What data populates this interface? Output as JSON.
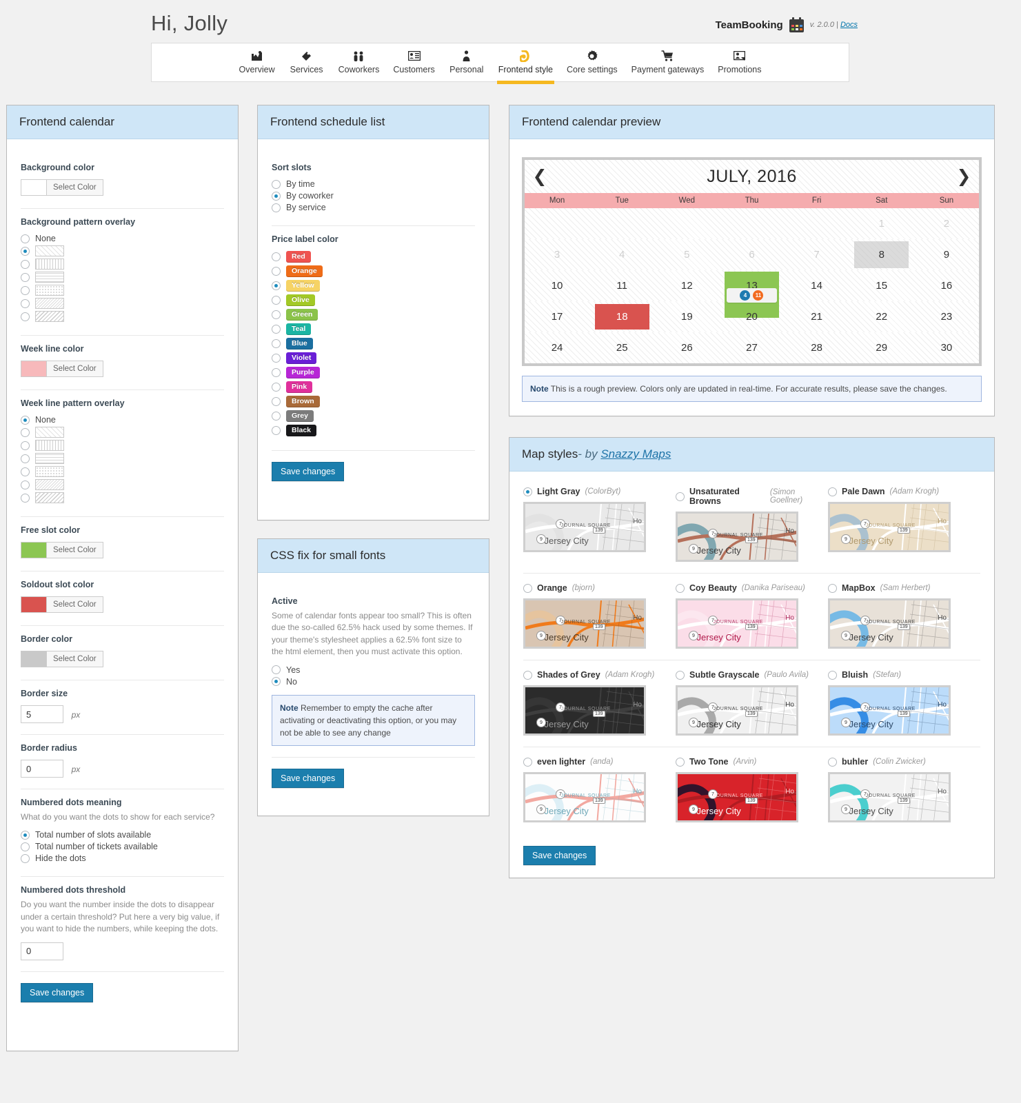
{
  "header": {
    "greeting": "Hi, Jolly",
    "brand": "TeamBooking",
    "version": "v. 2.0.0",
    "sep": "|",
    "docs": "Docs",
    "logo_icon": "calendar-logo-icon"
  },
  "nav": {
    "tabs": [
      {
        "label": "Overview",
        "icon": "chart-icon",
        "active": false
      },
      {
        "label": "Services",
        "icon": "tag-icon",
        "active": false
      },
      {
        "label": "Coworkers",
        "icon": "people-icon",
        "active": false
      },
      {
        "label": "Customers",
        "icon": "contact-card-icon",
        "active": false
      },
      {
        "label": "Personal",
        "icon": "person-icon",
        "active": false
      },
      {
        "label": "Frontend style",
        "icon": "brush-icon",
        "active": true
      },
      {
        "label": "Core settings",
        "icon": "gear-icon",
        "active": false
      },
      {
        "label": "Payment gateways",
        "icon": "cart-icon",
        "active": false
      },
      {
        "label": "Promotions",
        "icon": "megaphone-icon",
        "active": false
      }
    ],
    "accent": "#f5b820"
  },
  "frontend_calendar": {
    "title": "Frontend calendar",
    "background_color": {
      "label": "Background color",
      "swatch": "#ffffff",
      "button": "Select Color"
    },
    "background_pattern": {
      "label": "Background pattern overlay",
      "none_label": "None",
      "selected_index": 1,
      "count": 7
    },
    "week_line_color": {
      "label": "Week line color",
      "swatch": "#f7b9bb",
      "button": "Select Color"
    },
    "week_line_pattern": {
      "label": "Week line pattern overlay",
      "none_label": "None",
      "selected_index": 0,
      "count": 7
    },
    "free_slot_color": {
      "label": "Free slot color",
      "swatch": "#8cc653",
      "button": "Select Color"
    },
    "soldout_slot_color": {
      "label": "Soldout slot color",
      "swatch": "#d9534f",
      "button": "Select Color"
    },
    "border_color": {
      "label": "Border color",
      "swatch": "#c9c9c9",
      "button": "Select Color"
    },
    "border_size": {
      "label": "Border size",
      "value": "5",
      "unit": "px"
    },
    "border_radius": {
      "label": "Border radius",
      "value": "0",
      "unit": "px"
    },
    "numbered_dots_meaning": {
      "label": "Numbered dots meaning",
      "help": "What do you want the dots to show for each service?",
      "options": [
        "Total number of slots available",
        "Total number of tickets available",
        "Hide the dots"
      ],
      "selected_index": 0
    },
    "numbered_dots_threshold": {
      "label": "Numbered dots threshold",
      "help": "Do you want the number inside the dots to disappear under a certain threshold? Put here a very big value, if you want to hide the numbers, while keeping the dots.",
      "value": "0"
    },
    "save_label": "Save changes"
  },
  "frontend_schedule_list": {
    "title": "Frontend schedule list",
    "sort_slots": {
      "label": "Sort slots",
      "options": [
        "By time",
        "By coworker",
        "By service"
      ],
      "selected_index": 1
    },
    "price_label_color": {
      "label": "Price label color",
      "selected_index": 2,
      "options": [
        {
          "name": "Red",
          "color": "#ef5350"
        },
        {
          "name": "Orange",
          "color": "#ef6c18"
        },
        {
          "name": "Yellow",
          "color": "#f6d365"
        },
        {
          "name": "Olive",
          "color": "#a3c926"
        },
        {
          "name": "Green",
          "color": "#8bc34a"
        },
        {
          "name": "Teal",
          "color": "#1bb5a3"
        },
        {
          "name": "Blue",
          "color": "#1b6fa0"
        },
        {
          "name": "Violet",
          "color": "#6a1fd6"
        },
        {
          "name": "Purple",
          "color": "#b726d6"
        },
        {
          "name": "Pink",
          "color": "#e0309b"
        },
        {
          "name": "Brown",
          "color": "#a96a39"
        },
        {
          "name": "Grey",
          "color": "#7c7c7c"
        },
        {
          "name": "Black",
          "color": "#18181a"
        }
      ]
    },
    "save_label": "Save changes"
  },
  "css_fix": {
    "title": "CSS fix for small fonts",
    "active_label": "Active",
    "description": "Some of calendar fonts appear too small? This is often due the so-called 62.5% hack used by some themes. If your theme's stylesheet applies a 62.5% font size to the html element, then you must activate this option.",
    "options": [
      "Yes",
      "No"
    ],
    "selected_index": 1,
    "note_title": "Note",
    "note_text": "Remember to empty the cache after activating or deactivating this option, or you may not be able to see any change",
    "save_label": "Save changes"
  },
  "calendar_preview": {
    "title": "Frontend calendar preview",
    "month": "JULY, 2016",
    "prev_icon": "chevron-left-icon",
    "next_icon": "chevron-right-icon",
    "dow": [
      "Mon",
      "Tue",
      "Wed",
      "Thu",
      "Fri",
      "Sat",
      "Sun"
    ],
    "weeks": [
      [
        {
          "d": "",
          "s": "empty"
        },
        {
          "d": "",
          "s": "empty"
        },
        {
          "d": "",
          "s": "empty"
        },
        {
          "d": "",
          "s": "empty"
        },
        {
          "d": "",
          "s": "empty"
        },
        {
          "d": "1",
          "s": "mut"
        },
        {
          "d": "2",
          "s": "mut"
        }
      ],
      [
        {
          "d": "3",
          "s": "mut"
        },
        {
          "d": "4",
          "s": "mut"
        },
        {
          "d": "5",
          "s": "mut"
        },
        {
          "d": "6",
          "s": "mut"
        },
        {
          "d": "7",
          "s": "mut"
        },
        {
          "d": "8",
          "s": "today"
        },
        {
          "d": "9",
          "s": "normal"
        }
      ],
      [
        {
          "d": "10",
          "s": "normal"
        },
        {
          "d": "11",
          "s": "normal"
        },
        {
          "d": "12",
          "s": "normal"
        },
        {
          "d": "13",
          "s": "free"
        },
        {
          "d": "14",
          "s": "normal"
        },
        {
          "d": "15",
          "s": "normal"
        },
        {
          "d": "16",
          "s": "normal"
        }
      ],
      [
        {
          "d": "17",
          "s": "normal"
        },
        {
          "d": "18",
          "s": "sold"
        },
        {
          "d": "19",
          "s": "normal"
        },
        {
          "d": "20",
          "s": "normal"
        },
        {
          "d": "21",
          "s": "normal"
        },
        {
          "d": "22",
          "s": "normal"
        },
        {
          "d": "23",
          "s": "normal"
        }
      ],
      [
        {
          "d": "24",
          "s": "normal"
        },
        {
          "d": "25",
          "s": "normal"
        },
        {
          "d": "26",
          "s": "normal"
        },
        {
          "d": "27",
          "s": "normal"
        },
        {
          "d": "28",
          "s": "normal"
        },
        {
          "d": "29",
          "s": "normal"
        },
        {
          "d": "30",
          "s": "normal"
        }
      ]
    ],
    "dots": [
      {
        "value": "4",
        "color": "#1e7bb0"
      },
      {
        "value": "11",
        "color": "#f26b21"
      }
    ],
    "note_title": "Note",
    "note_text": "This is a rough preview. Colors only are updated in real-time. For accurate results, please save the changes."
  },
  "map_styles": {
    "title": "Map styles",
    "by_text": "- by ",
    "credit": "Snazzy Maps",
    "selected_index": 0,
    "city_label": "Jersey City",
    "square_label": "JOURNAL SQUARE",
    "items": [
      {
        "name": "Light Gray",
        "author": "(ColorByt)",
        "bg": "#e9e9e9",
        "road": "#ffffff",
        "water": "#e0e0e0",
        "text": "#5a5a5a",
        "city": "#5a5a5a"
      },
      {
        "name": "Unsaturated Browns",
        "author": "(Simon Goellner)",
        "bg": "#e6e2dc",
        "road": "#b5705a",
        "water": "#6d9ca8",
        "text": "#4a4a4a",
        "city": "#3e3e3e"
      },
      {
        "name": "Pale Dawn",
        "author": "(Adam Krogh)",
        "bg": "#ecdfc8",
        "road": "#ffffff",
        "water": "#a0bcd0",
        "text": "#b09a6f",
        "city": "#b09a6f"
      },
      {
        "name": "Orange",
        "author": "(bjorn)",
        "bg": "#d9c5b2",
        "road": "#f07b1c",
        "water": "#e8c39a",
        "text": "#5a4632",
        "city": "#4a3a28"
      },
      {
        "name": "Coy Beauty",
        "author": "(Danika Pariseau)",
        "bg": "#fbdde8",
        "road": "#ffffff",
        "water": "#fce9f0",
        "text": "#b03060",
        "city": "#b0194a"
      },
      {
        "name": "MapBox",
        "author": "(Sam Herbert)",
        "bg": "#e8e1d8",
        "road": "#ffffff",
        "water": "#63b3e8",
        "text": "#4a4a4a",
        "city": "#3e3e3e"
      },
      {
        "name": "Shades of Grey",
        "author": "(Adam Krogh)",
        "bg": "#2b2b2b",
        "road": "#3e3e3e",
        "water": "#383838",
        "text": "#9a9a9a",
        "city": "#9a9a9a"
      },
      {
        "name": "Subtle Grayscale",
        "author": "(Paulo Avila)",
        "bg": "#f0f0f0",
        "road": "#ffffff",
        "water": "#9c9c9c",
        "text": "#3e3e3e",
        "city": "#2e2e2e"
      },
      {
        "name": "Bluish",
        "author": "(Stefan)",
        "bg": "#bcdcfa",
        "road": "#ffffff",
        "water": "#1f7fe0",
        "text": "#2e4a6a",
        "city": "#2e4a6a"
      },
      {
        "name": "even lighter",
        "author": "(anda)",
        "bg": "#fdfdfd",
        "road": "#f2a8a0",
        "water": "#d7ecf5",
        "text": "#6fa8b8",
        "city": "#6fa8b8"
      },
      {
        "name": "Two Tone",
        "author": "(Arvin)",
        "bg": "#d8232a",
        "road": "#b01c22",
        "water": "#14112b",
        "text": "#ffd0d0",
        "city": "#ffffff"
      },
      {
        "name": "buhler",
        "author": "(Colin Zwicker)",
        "bg": "#f2f2f2",
        "road": "#ffffff",
        "water": "#2ec8c8",
        "text": "#5a5a5a",
        "city": "#4a4a4a"
      }
    ],
    "save_label": "Save changes"
  }
}
